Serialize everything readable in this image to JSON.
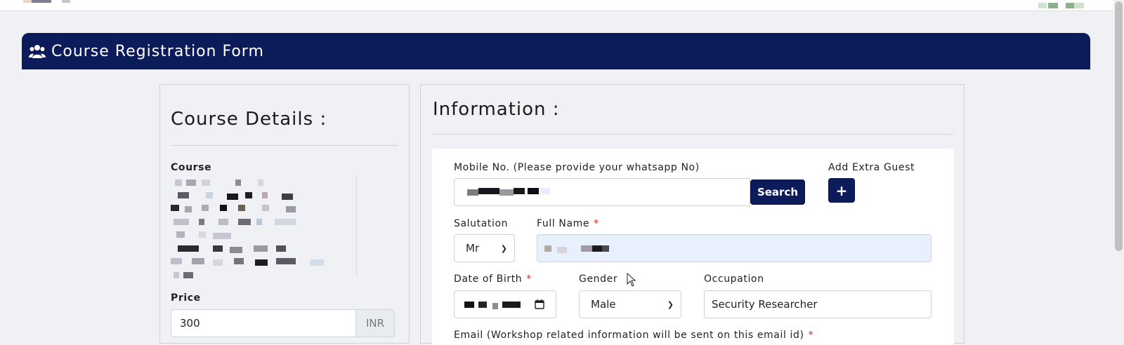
{
  "banner": {
    "title": "Course Registration Form"
  },
  "course_details": {
    "heading": "Course Details :",
    "course_label": "Course",
    "price_label": "Price",
    "price_value": "300",
    "currency": "INR"
  },
  "information": {
    "heading": "Information :",
    "mobile_label": "Mobile No. (Please provide your whatsapp No)",
    "search_button": "Search",
    "extra_guest_label": "Add Extra Guest",
    "extra_guest_button": "+",
    "salutation_label": "Salutation",
    "salutation_value": "Mr",
    "fullname_label": "Full Name",
    "required_mark": "*",
    "dob_label": "Date of Birth",
    "gender_label": "Gender",
    "gender_value": "Male",
    "occupation_label": "Occupation",
    "occupation_value": "Security Researcher",
    "email_label": "Email (Workshop related information will be sent on this email id)"
  },
  "colors": {
    "navy": "#0c1b5a",
    "required": "#d02b2b",
    "autofill": "#e8f0fe"
  },
  "icons": {
    "banner": "users-icon",
    "calendar": "calendar-icon",
    "select": "chevron-down-icon"
  }
}
